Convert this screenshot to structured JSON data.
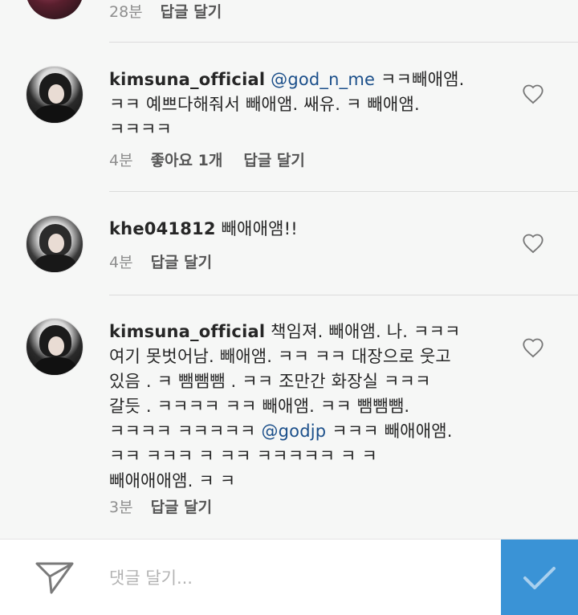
{
  "top_partial": {
    "time": "28분",
    "reply_label": "답글 달기"
  },
  "comments": [
    {
      "username": "kimsuna_official",
      "mention": "@god_n_me",
      "text_lines": [
        "ㅋㅋ빼애앰.",
        "ㅋㅋ 예쁘다해줘서 빼애앰. 쌔유. ㅋ 빼애앰.",
        "ㅋㅋㅋㅋ"
      ],
      "time": "4분",
      "likes": "좋아요 1개",
      "reply_label": "답글 달기"
    },
    {
      "username": "khe041812",
      "text": "빼애애앰!!",
      "time": "4분",
      "reply_label": "답글 달기"
    },
    {
      "username": "kimsuna_official",
      "lines": [
        "책임져. 빼애앰. 나. ㅋㅋㅋ",
        "여기 못벗어남. 빼애앰. ㅋㅋ ㅋㅋ  대장으로 웃고",
        "있음 . ㅋ 뺌뺌뺌 . ㅋㅋ 조만간 화장실 ㅋㅋㅋ",
        "갈듯 . ㅋㅋㅋㅋ ㅋㅋ  빼애앰. ㅋㅋ 뺌뺌뺌.",
        "ㅋㅋㅋㅋ ㅋㅋㅋㅋㅋ",
        "ㅋㅋㅋ 빼애애앰.",
        "ㅋㅋ ㅋㅋㅋ ㅋ ㅋㅋ ㅋㅋㅋㅋㅋ  ㅋ ㅋ",
        "빼애애애앰. ㅋ ㅋ"
      ],
      "mention": "@godjp",
      "time": "3분",
      "reply_label": "답글 달기"
    }
  ],
  "input": {
    "placeholder": "댓글 달기..."
  },
  "colors": {
    "accent": "#3a93d6",
    "mention": "#1b4f8a",
    "background": "#f6f7f6"
  },
  "icons": {
    "send": "send-icon",
    "heart": "heart-icon",
    "submit": "checkmark-icon"
  }
}
